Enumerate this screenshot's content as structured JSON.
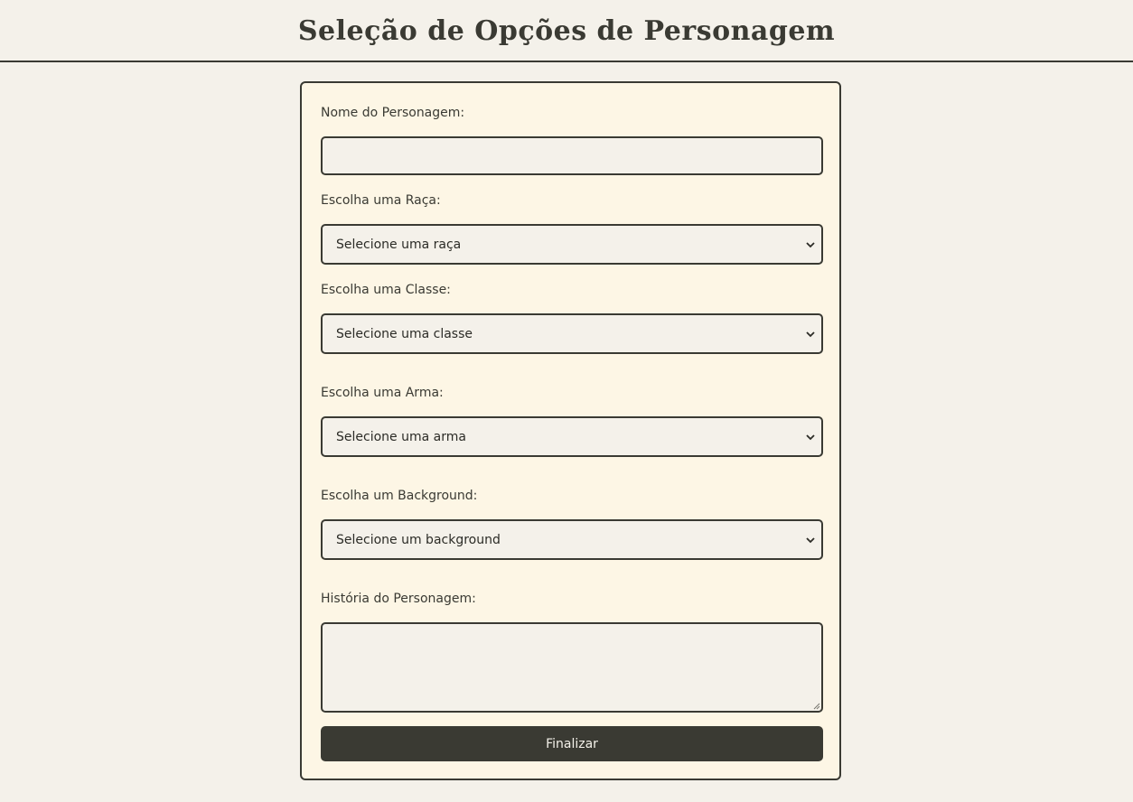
{
  "header": {
    "title": "Seleção de Opções de Personagem"
  },
  "form": {
    "name": {
      "label": "Nome do Personagem:",
      "value": ""
    },
    "race": {
      "label": "Escolha uma Raça:",
      "selected": "Selecione uma raça"
    },
    "class": {
      "label": "Escolha uma Classe:",
      "selected": "Selecione uma classe"
    },
    "weapon": {
      "label": "Escolha uma Arma:",
      "selected": "Selecione uma arma"
    },
    "background": {
      "label": "Escolha um Background:",
      "selected": "Selecione um background"
    },
    "story": {
      "label": "História do Personagem:",
      "value": ""
    },
    "submit_label": "Finalizar"
  },
  "colors": {
    "page_background": "#f4f1ea",
    "card_background": "#fdf6e5",
    "ink": "#3a3a33"
  },
  "icons": {
    "select": "chevron-down-icon",
    "textarea": "resize-grip-icon"
  }
}
